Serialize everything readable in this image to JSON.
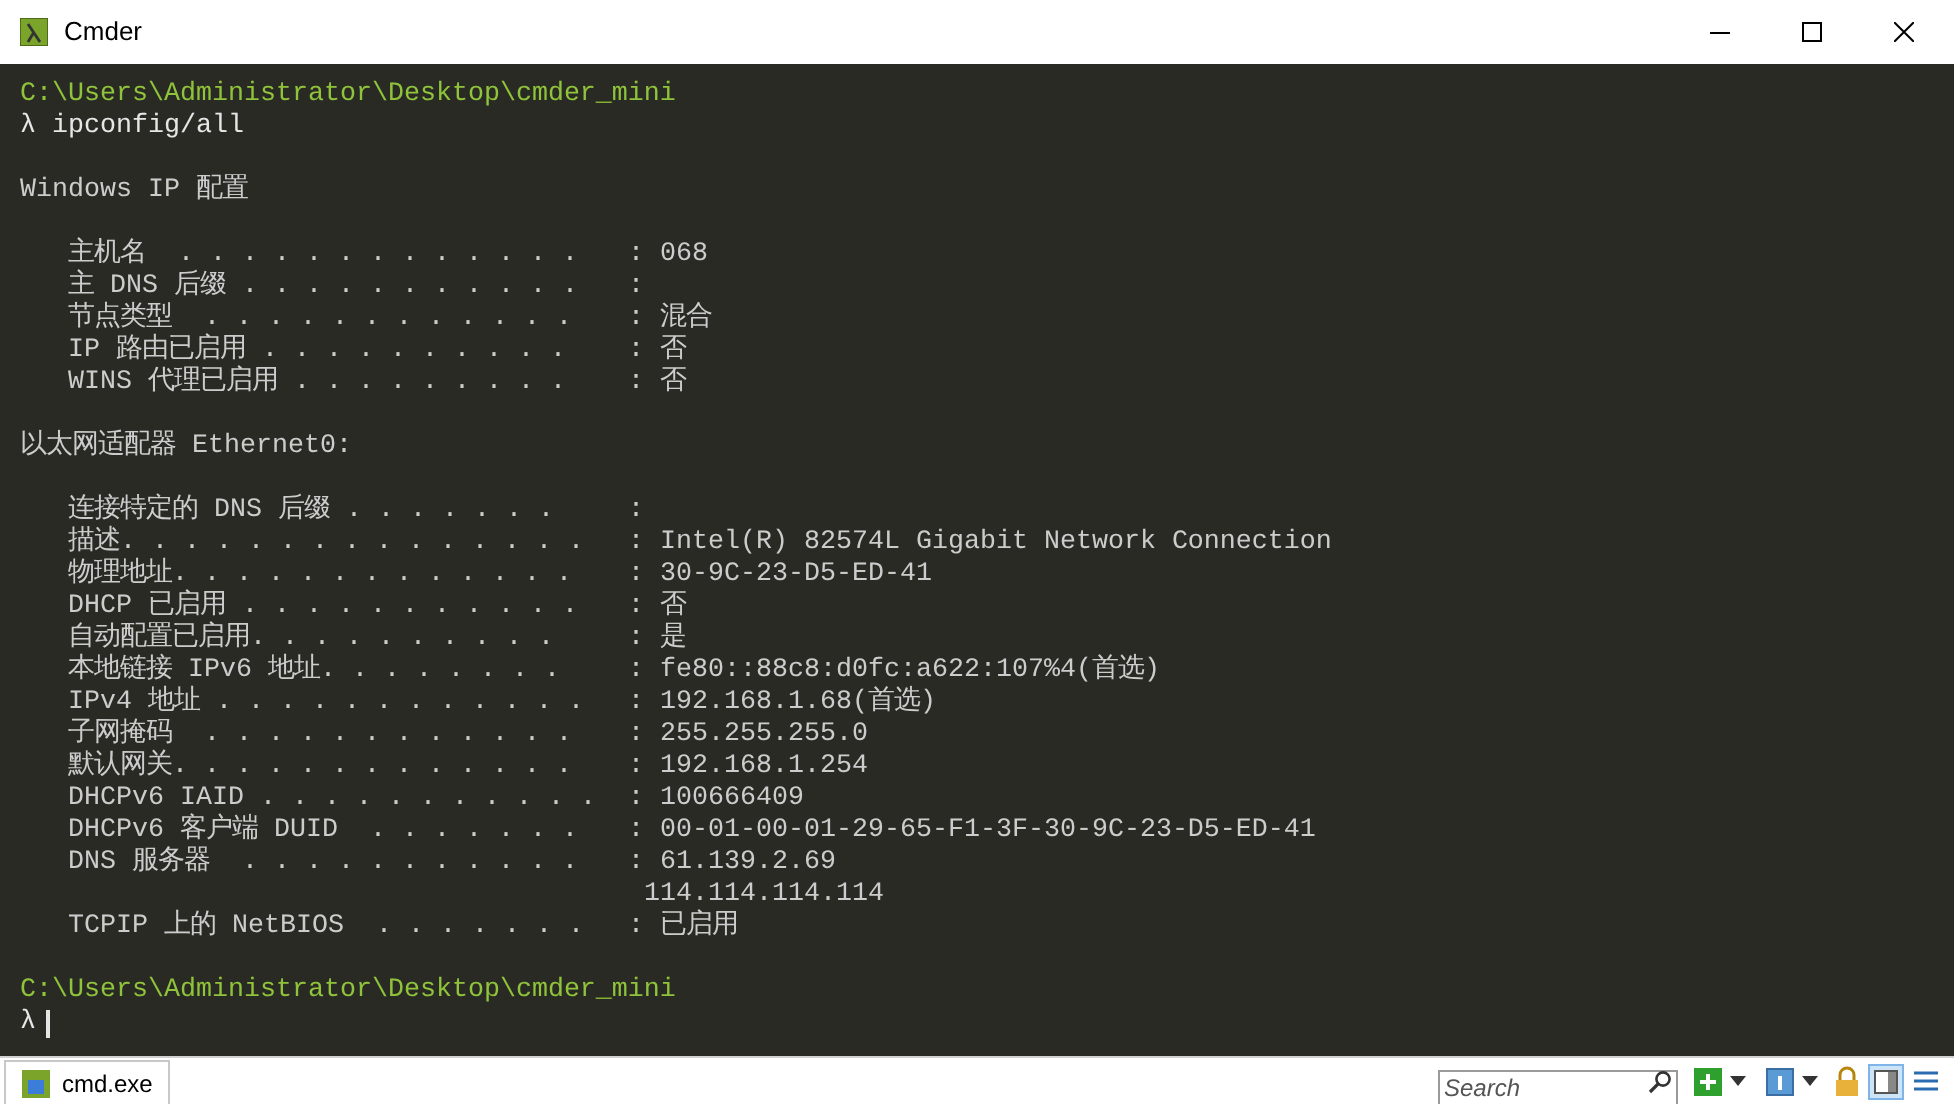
{
  "window": {
    "title": "Cmder"
  },
  "terminal": {
    "lines": [
      {
        "kind": "path",
        "text": "C:\\Users\\Administrator\\Desktop\\cmder_mini"
      },
      {
        "kind": "command",
        "prompt": "λ",
        "text": "ipconfig/all"
      },
      {
        "kind": "blank"
      },
      {
        "kind": "heading",
        "text": "Windows IP 配置"
      },
      {
        "kind": "blank"
      },
      {
        "kind": "entry",
        "label": "主机名  . . . . . . . . . . . . .",
        "value": ": 068"
      },
      {
        "kind": "entry",
        "label": "主 DNS 后缀 . . . . . . . . . . .",
        "value": ":"
      },
      {
        "kind": "entry",
        "label": "节点类型  . . . . . . . . . . . .",
        "value": ": 混合"
      },
      {
        "kind": "entry",
        "label": "IP 路由已启用 . . . . . . . . . .",
        "value": ": 否"
      },
      {
        "kind": "entry",
        "label": "WINS 代理已启用 . . . . . . . . .",
        "value": ": 否"
      },
      {
        "kind": "blank"
      },
      {
        "kind": "heading",
        "text": "以太网适配器 Ethernet0:"
      },
      {
        "kind": "blank"
      },
      {
        "kind": "entry",
        "label": "连接特定的 DNS 后缀 . . . . . . .",
        "value": ":"
      },
      {
        "kind": "entry",
        "label": "描述. . . . . . . . . . . . . . .",
        "value": ": Intel(R) 82574L Gigabit Network Connection"
      },
      {
        "kind": "entry",
        "label": "物理地址. . . . . . . . . . . . .",
        "value": ": 30-9C-23-D5-ED-41"
      },
      {
        "kind": "entry",
        "label": "DHCP 已启用 . . . . . . . . . . .",
        "value": ": 否"
      },
      {
        "kind": "entry",
        "label": "自动配置已启用. . . . . . . . . .",
        "value": ": 是"
      },
      {
        "kind": "entry",
        "label": "本地链接 IPv6 地址. . . . . . . .",
        "value": ": fe80::88c8:d0fc:a622:107%4(首选)"
      },
      {
        "kind": "entry",
        "label": "IPv4 地址 . . . . . . . . . . . .",
        "value": ": 192.168.1.68(首选)"
      },
      {
        "kind": "entry",
        "label": "子网掩码  . . . . . . . . . . . .",
        "value": ": 255.255.255.0"
      },
      {
        "kind": "entry",
        "label": "默认网关. . . . . . . . . . . . .",
        "value": ": 192.168.1.254"
      },
      {
        "kind": "entry",
        "label": "DHCPv6 IAID . . . . . . . . . . .",
        "value": ": 100666409"
      },
      {
        "kind": "entry",
        "label": "DHCPv6 客户端 DUID  . . . . . . .",
        "value": ": 00-01-00-01-29-65-F1-3F-30-9C-23-D5-ED-41"
      },
      {
        "kind": "entry",
        "label": "DNS 服务器  . . . . . . . . . . .",
        "value": ": 61.139.2.69"
      },
      {
        "kind": "continuation",
        "value": "114.114.114.114"
      },
      {
        "kind": "entry",
        "label": "TCPIP 上的 NetBIOS  . . . . . . .",
        "value": ": 已启用"
      },
      {
        "kind": "blank"
      },
      {
        "kind": "path",
        "text": "C:\\Users\\Administrator\\Desktop\\cmder_mini"
      },
      {
        "kind": "prompt",
        "prompt": "λ"
      }
    ]
  },
  "tabs": [
    {
      "label": "cmd.exe",
      "selected": true
    }
  ],
  "search": {
    "placeholder": "Search"
  }
}
